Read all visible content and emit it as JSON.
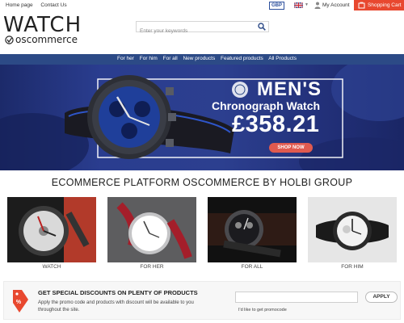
{
  "topbar": {
    "links": [
      "Home page",
      "Contact Us"
    ],
    "currency": "GBP",
    "account": "My Account",
    "cart": "Shopping Cart"
  },
  "header": {
    "logo_word": "WATCH",
    "logo_sub": "oscommerce",
    "search_placeholder": "Enter your keywords"
  },
  "nav": {
    "items": [
      "For her",
      "For him",
      "For all",
      "New products",
      "Featured products",
      "All Products"
    ]
  },
  "banner": {
    "line1": "MEN'S",
    "line2": "Chronograph Watch",
    "price": "£358.21",
    "button": "SHOP NOW"
  },
  "section_title": "ECOMMERCE PLATFORM OSCOMMERCE BY HOLBI GROUP",
  "categories": [
    {
      "label": "WATCH"
    },
    {
      "label": "FOR HER"
    },
    {
      "label": "FOR ALL"
    },
    {
      "label": "FOR HIM"
    }
  ],
  "promo": {
    "title": "GET SPECIAL DISCOUNTS ON PLENTY OF PRODUCTS",
    "description": "Apply the promo code and products with discount will be available to you throughout the site.",
    "button": "APPLY",
    "hint": "I'd like to get promocode"
  },
  "colors": {
    "nav_bg": "#2c4a86",
    "cart_bg": "#e8482f",
    "shop_button": "#e05a4f",
    "promo_icon": "#e8482f"
  }
}
